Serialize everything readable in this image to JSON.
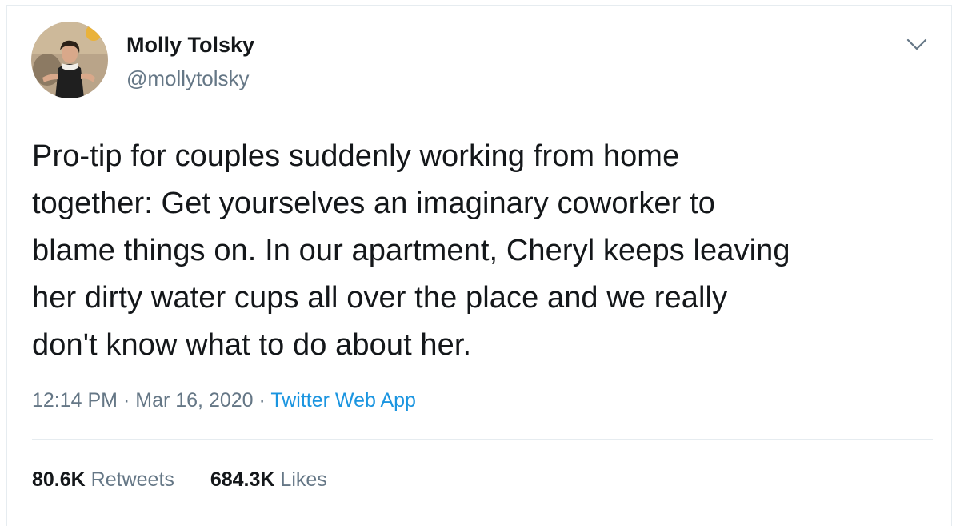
{
  "tweet": {
    "author": {
      "display_name": "Molly Tolsky",
      "handle": "@mollytolsky"
    },
    "text": "Pro-tip for couples suddenly working from home\ntogether: Get yourselves an imaginary coworker to\nblame things on. In our apartment, Cheryl keeps leaving\nher dirty water cups all over the place and we really\ndon't know what to do about her.",
    "time": "12:14 PM",
    "separator": "·",
    "date": "Mar 16, 2020",
    "source": "Twitter Web App",
    "stats": {
      "retweets_count": "80.6K",
      "retweets_label": "Retweets",
      "likes_count": "684.3K",
      "likes_label": "Likes"
    },
    "menu_icon": "chevron-down-icon"
  },
  "colors": {
    "text": "#14171a",
    "secondary": "#657786",
    "link": "#1b95e0",
    "border": "#e6ecf0"
  }
}
